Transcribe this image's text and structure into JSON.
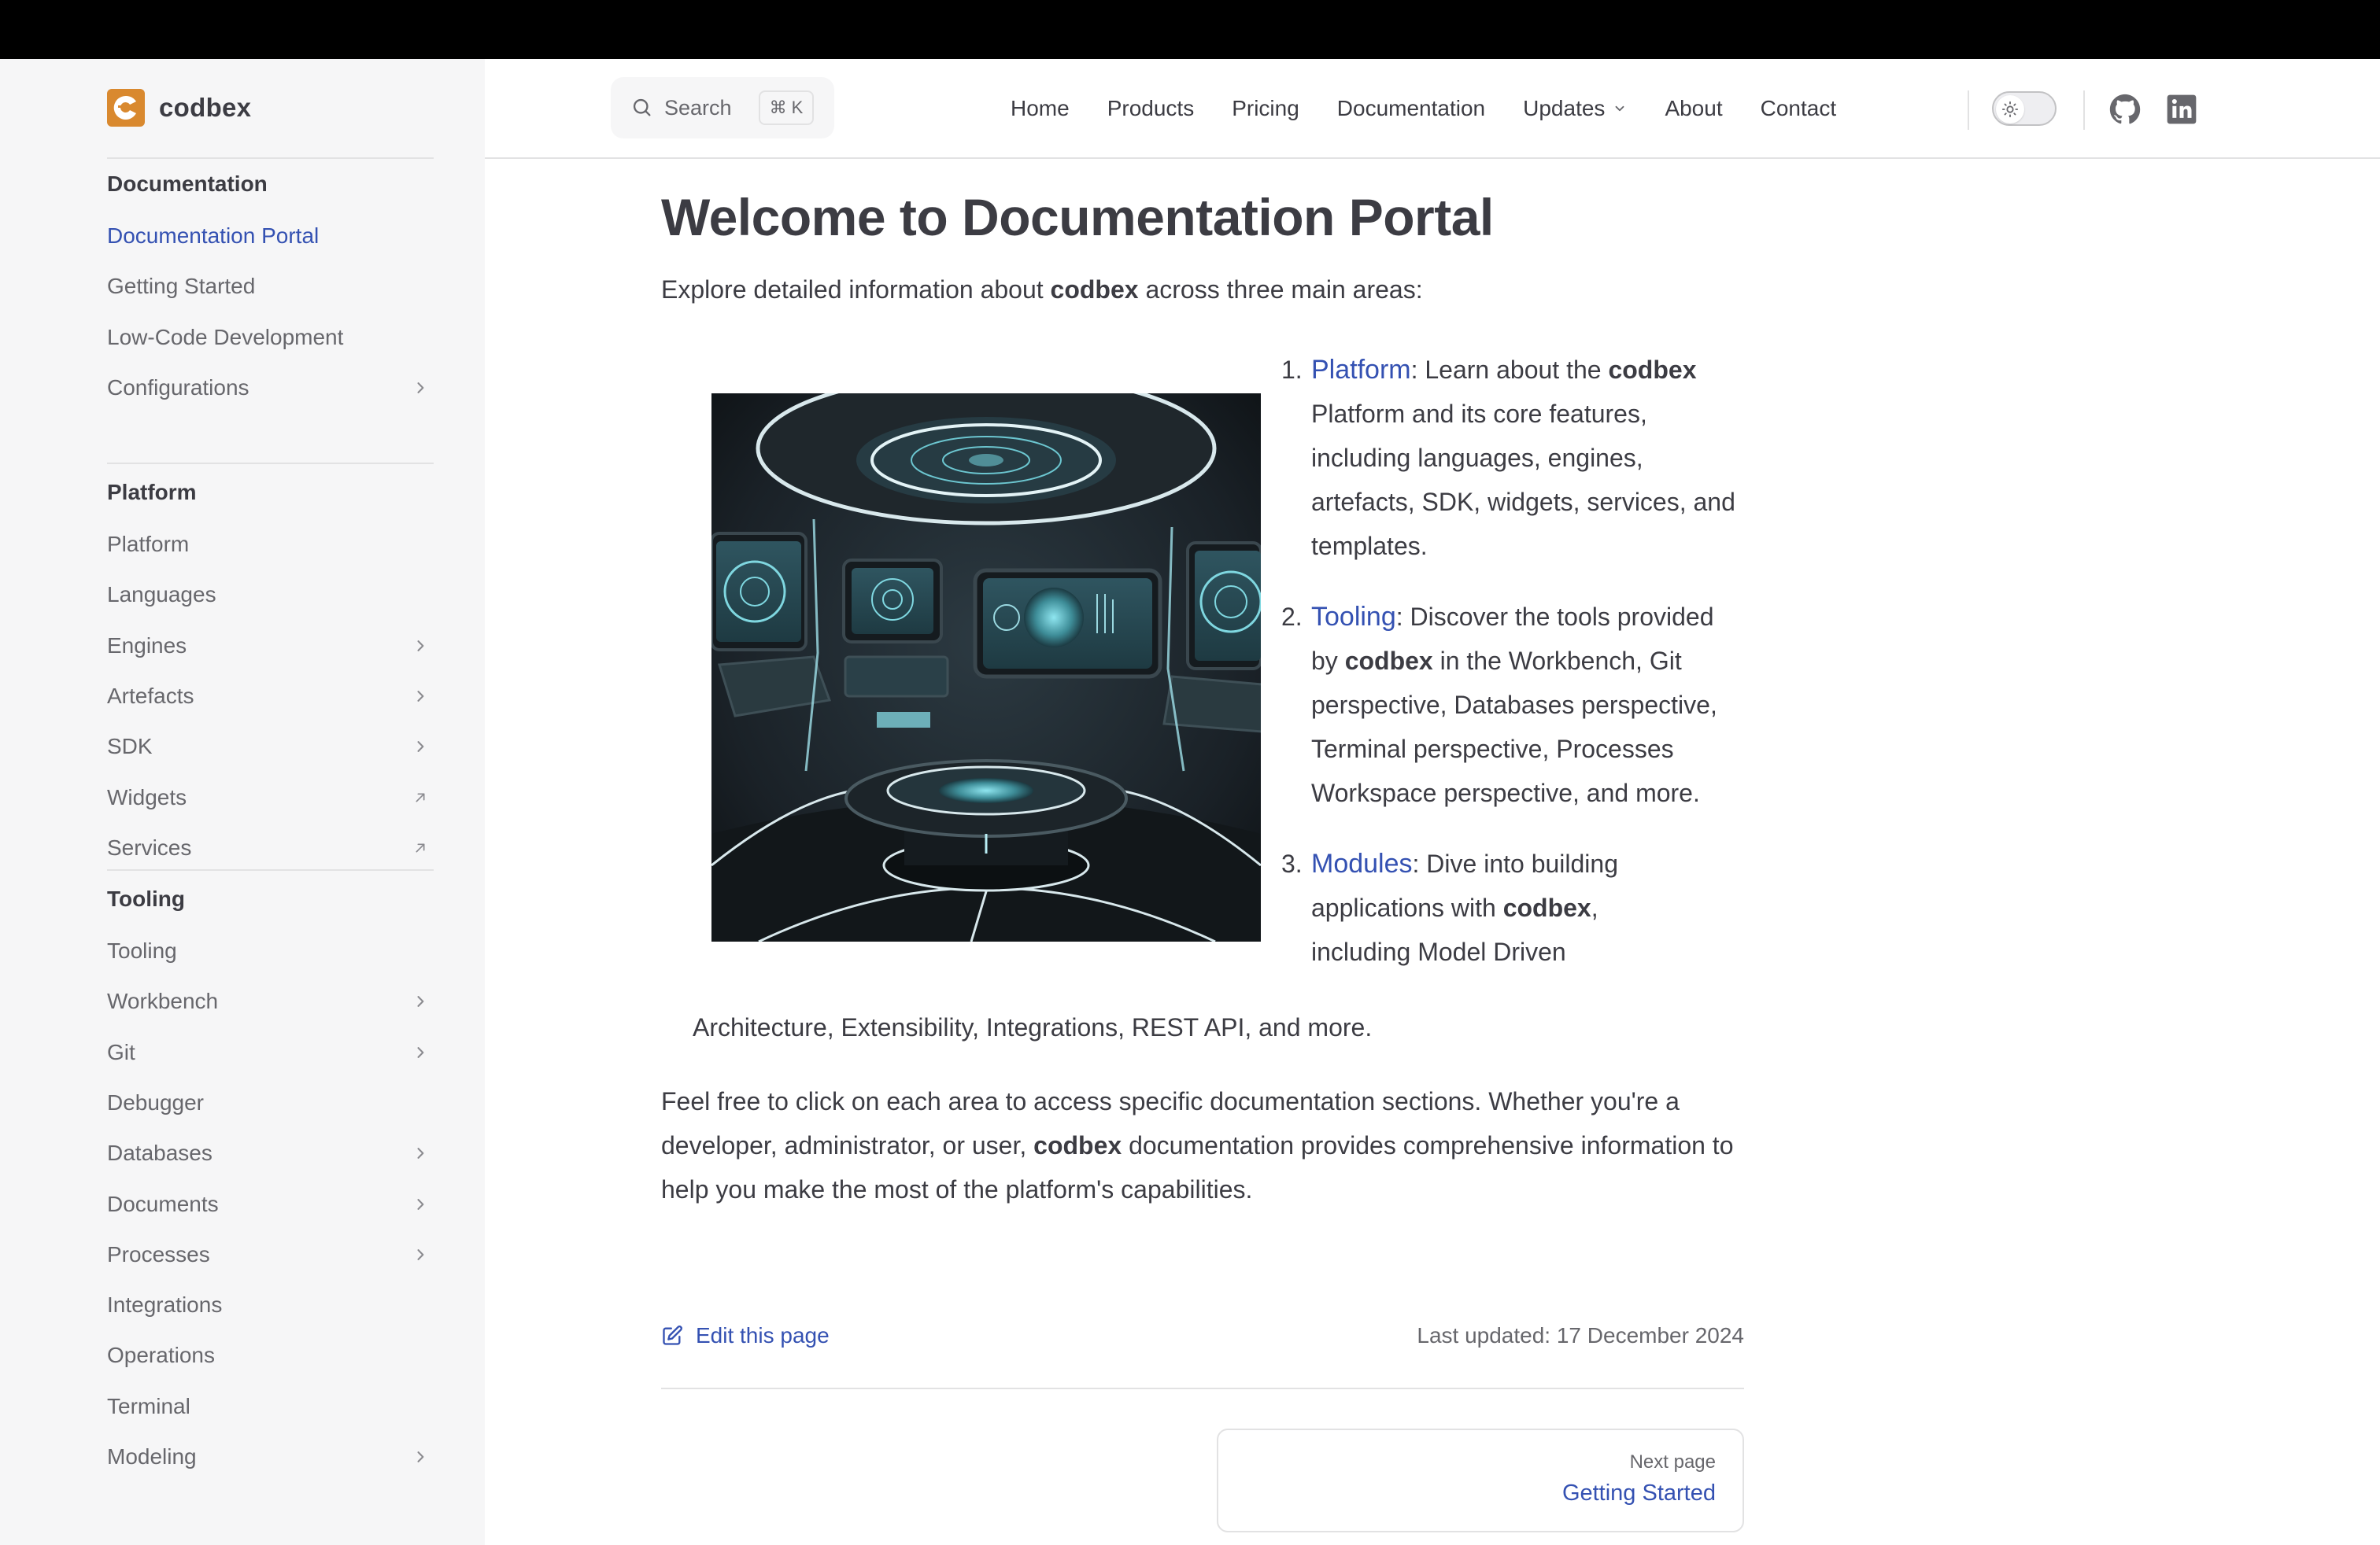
{
  "brand": {
    "name": "codbex",
    "color": "#d9892f"
  },
  "search": {
    "label": "Search",
    "shortcut": "⌘ K"
  },
  "nav": {
    "items": [
      {
        "label": "Home"
      },
      {
        "label": "Products"
      },
      {
        "label": "Pricing"
      },
      {
        "label": "Documentation"
      },
      {
        "label": "Updates",
        "has_dropdown": true
      },
      {
        "label": "About"
      },
      {
        "label": "Contact"
      }
    ],
    "theme_toggle": "light",
    "social": [
      "github-icon",
      "linkedin-icon"
    ]
  },
  "sidebar": {
    "groups": [
      {
        "title": "Documentation",
        "items": [
          {
            "label": "Documentation Portal",
            "active": true
          },
          {
            "label": "Getting Started"
          },
          {
            "label": "Low-Code Development"
          },
          {
            "label": "Configurations",
            "icon": "chevron-right"
          }
        ]
      },
      {
        "title": "Platform",
        "items": [
          {
            "label": "Platform"
          },
          {
            "label": "Languages"
          },
          {
            "label": "Engines",
            "icon": "chevron-right"
          },
          {
            "label": "Artefacts",
            "icon": "chevron-right"
          },
          {
            "label": "SDK",
            "icon": "chevron-right"
          },
          {
            "label": "Widgets",
            "icon": "external-link"
          },
          {
            "label": "Services",
            "icon": "external-link"
          }
        ]
      },
      {
        "title": "Tooling",
        "items": [
          {
            "label": "Tooling"
          },
          {
            "label": "Workbench",
            "icon": "chevron-right"
          },
          {
            "label": "Git",
            "icon": "chevron-right"
          },
          {
            "label": "Debugger"
          },
          {
            "label": "Databases",
            "icon": "chevron-right"
          },
          {
            "label": "Documents",
            "icon": "chevron-right"
          },
          {
            "label": "Processes",
            "icon": "chevron-right"
          },
          {
            "label": "Integrations"
          },
          {
            "label": "Operations"
          },
          {
            "label": "Terminal"
          },
          {
            "label": "Modeling",
            "icon": "chevron-right"
          }
        ]
      }
    ]
  },
  "main": {
    "title": "Welcome to Documentation Portal",
    "intro": {
      "before": "Explore detailed information about ",
      "bold": "codbex",
      "after": " across three main areas:"
    },
    "image_alt": "Futuristic control room with holographic displays",
    "list": [
      {
        "link": "Platform",
        "segments": [
          ": Learn about the ",
          "codbex",
          " Platform and its core features, including languages, engines, artefacts, SDK, widgets, services, and templates."
        ]
      },
      {
        "link": "Tooling",
        "segments": [
          ": Discover the tools provided by ",
          "codbex",
          " in the Workbench, Git perspective, Databases perspective, Terminal perspective, Processes Workspace perspective, and more."
        ]
      },
      {
        "link": "Modules",
        "segments": [
          ": Dive into building applications with ",
          "codbex",
          ", including Model Driven"
        ],
        "tail": "Architecture, Extensibility, Integrations, REST API, and more."
      }
    ],
    "outro": {
      "before": "Feel free to click on each area to access specific documentation sections. Whether you're a developer, administrator, or user, ",
      "bold": "codbex",
      "after": " documentation provides comprehensive information to help you make the most of the platform's capabilities."
    },
    "edit_link": "Edit this page",
    "last_updated": "Last updated: 17 December 2024",
    "next": {
      "desc": "Next page",
      "title": "Getting Started"
    }
  },
  "colors": {
    "accent": "#3451b2",
    "text": "#3c3c43",
    "muted": "#67676c",
    "sidebar_bg": "#f6f6f7"
  }
}
